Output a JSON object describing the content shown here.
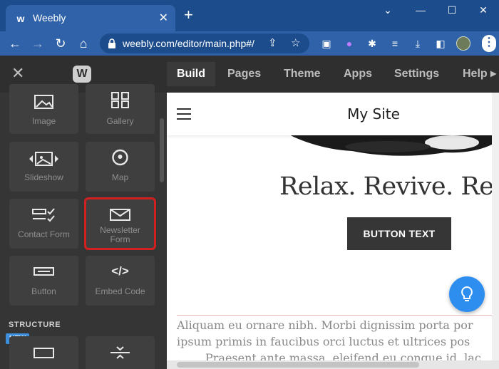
{
  "browser": {
    "tab_title": "Weebly",
    "url": "weebly.com/editor/main.php#/"
  },
  "editor": {
    "nav_tabs": [
      "Build",
      "Pages",
      "Theme",
      "Apps",
      "Settings",
      "Help ▸"
    ],
    "active_tab": "Build"
  },
  "sidebar": {
    "tiles": [
      {
        "label": "Image",
        "icon": "image-icon"
      },
      {
        "label": "Gallery",
        "icon": "gallery-icon"
      },
      {
        "label": "Slideshow",
        "icon": "slideshow-icon"
      },
      {
        "label": "Map",
        "icon": "map-icon"
      },
      {
        "label": "Contact Form",
        "icon": "contact-form-icon"
      },
      {
        "label": "Newsletter Form",
        "label_line1": "Newsletter",
        "label_line2": "Form",
        "icon": "envelope-icon",
        "highlighted": true
      },
      {
        "label": "Button",
        "icon": "button-icon"
      },
      {
        "label": "Embed Code",
        "icon": "code-icon"
      }
    ],
    "section_label": "STRUCTURE",
    "new_badge": "NEW"
  },
  "site": {
    "title": "My Site",
    "tagline": "Relax. Revive. Repeat",
    "button_text": "BUTTON TEXT",
    "paragraph_lines": [
      "Aliquam eu ornare nibh. Morbi dignissim porta por",
      "ipsum primis in faucibus orci luctus et ultrices pos",
      "Praesent ante massa, eleifend eu congue id, lac"
    ]
  },
  "colors": {
    "browser_frame": "#1d4c8c",
    "editor_dark": "#2f2f2f",
    "highlight_red": "#d21f1f",
    "help_blue": "#2e8ef0"
  }
}
